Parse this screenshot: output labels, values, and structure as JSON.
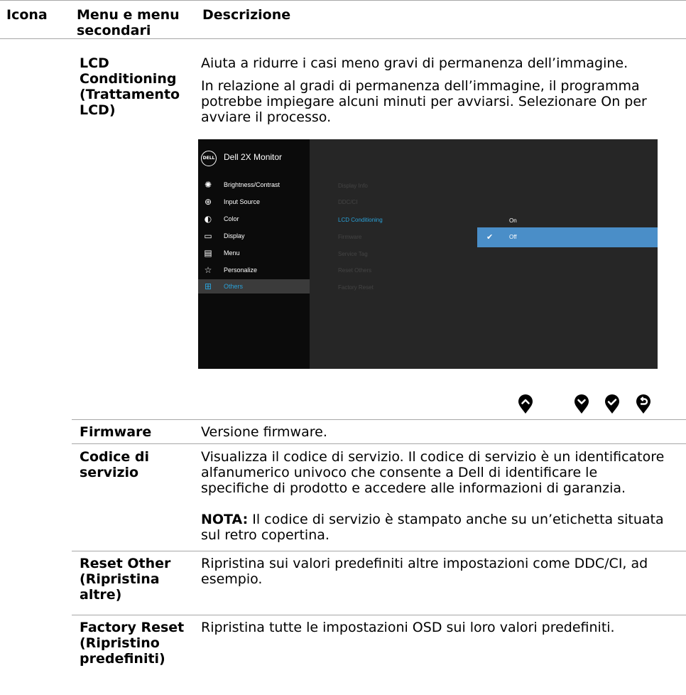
{
  "header": {
    "col_icon": "Icona",
    "col_menu": "Menu e menu secondari",
    "col_desc": "Descrizione"
  },
  "lcd": {
    "label": "LCD Conditioning (Trattamento LCD)",
    "desc1": "Aiuta a ridurre i casi meno gravi di permanenza dell’immagine.",
    "desc2": "In relazione al gradi di permanenza dell’immagine, il programma potrebbe impiegare alcuni minuti per avviarsi. Selezionare On per avviare il processo."
  },
  "osd": {
    "logo": "DELL",
    "title": "Dell 2X Monitor",
    "menu": [
      {
        "label": "Brightness/Contrast",
        "icon": "brightness-icon"
      },
      {
        "label": "Input Source",
        "icon": "input-source-icon"
      },
      {
        "label": "Color",
        "icon": "color-palette-icon"
      },
      {
        "label": "Display",
        "icon": "display-icon"
      },
      {
        "label": "Menu",
        "icon": "menu-icon"
      },
      {
        "label": "Personalize",
        "icon": "star-icon"
      },
      {
        "label": "Others",
        "icon": "others-icon"
      }
    ],
    "submenu": [
      "Display Info",
      "DDC/CI",
      "LCD Conditioning",
      "Firmware",
      "Service Tag",
      "Reset Others",
      "Factory Reset"
    ],
    "options": [
      "On",
      "Off"
    ],
    "accent_color": "#2aa1d8",
    "selected_bar_color": "#4a8ec8"
  },
  "nav_buttons": [
    "up-button-icon",
    "down-button-icon",
    "ok-check-button-icon",
    "back-button-icon"
  ],
  "rows": {
    "firmware": {
      "label": "Firmware",
      "desc": "Versione firmware."
    },
    "service": {
      "label": "Codice di servizio",
      "desc": "Visualizza il codice di servizio. Il codice di servizio è un identificatore alfanumerico univoco che consente a Dell di identificare le specifiche di prodotto e accedere alle informazioni di garanzia.",
      "note_label": "NOTA:",
      "note_text": " Il codice di servizio è stampato anche su un’etichetta situata sul retro copertina."
    },
    "reset_other": {
      "label": "Reset Other (Ripristina altre)",
      "desc": "Ripristina sui valori predefiniti altre impostazioni come DDC/CI, ad esempio."
    },
    "factory_reset": {
      "label": "Factory Reset (Ripristino predefiniti)",
      "desc": "Ripristina tutte le impostazioni OSD sui loro valori predefiniti."
    }
  }
}
